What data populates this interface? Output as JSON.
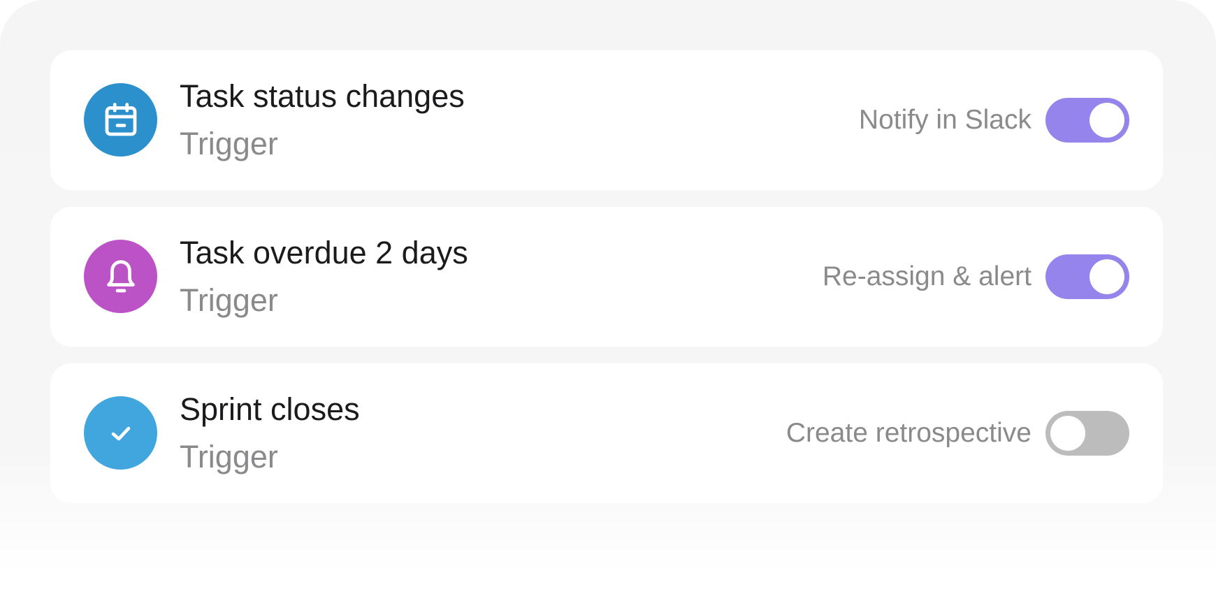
{
  "rules": [
    {
      "title": "Task status changes",
      "subtitle": "Trigger",
      "icon": "calendar-icon",
      "icon_color": "#2b90cb",
      "action_label": "Notify in Slack",
      "enabled": true
    },
    {
      "title": "Task overdue 2 days",
      "subtitle": "Trigger",
      "icon": "bell-icon",
      "icon_color": "#bb52c6",
      "action_label": "Re-assign & alert",
      "enabled": true
    },
    {
      "title": "Sprint closes",
      "subtitle": "Trigger",
      "icon": "check-icon",
      "icon_color": "#42a6de",
      "action_label": "Create retrospective",
      "enabled": false
    }
  ],
  "colors": {
    "toggle_on": "#9584ec",
    "toggle_off": "#bcbcbc"
  }
}
